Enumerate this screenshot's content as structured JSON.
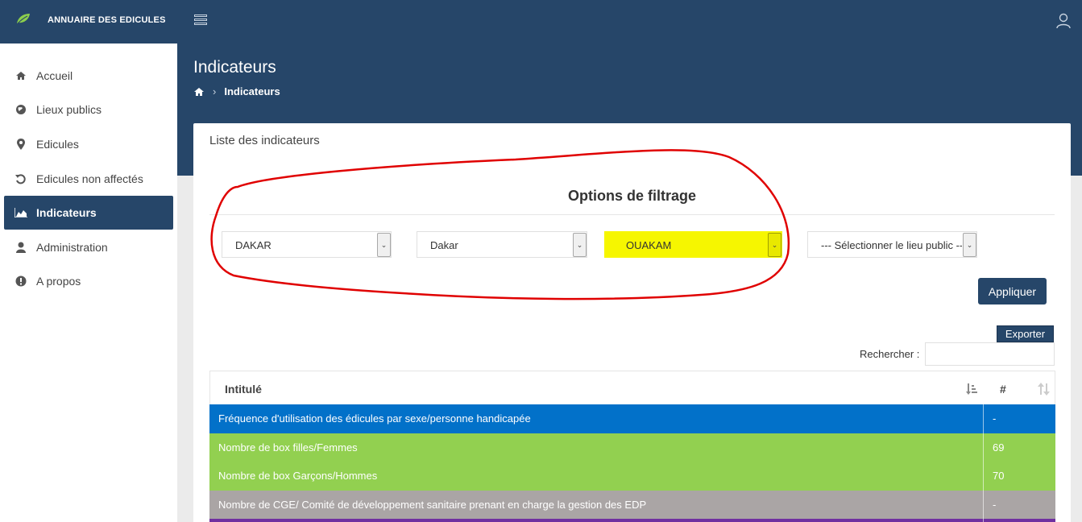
{
  "app": {
    "brand": "ANNUAIRE DES EDICULES"
  },
  "sidebar": {
    "items": [
      {
        "label": "Accueil",
        "icon": "home-icon"
      },
      {
        "label": "Lieux publics",
        "icon": "globe-icon"
      },
      {
        "label": "Edicules",
        "icon": "map-marker-icon"
      },
      {
        "label": "Edicules non affectés",
        "icon": "undo-icon"
      },
      {
        "label": "Indicateurs",
        "icon": "area-chart-icon",
        "active": true
      },
      {
        "label": "Administration",
        "icon": "user-icon"
      },
      {
        "label": "A propos",
        "icon": "info-icon"
      }
    ]
  },
  "header": {
    "title": "Indicateurs",
    "breadcrumb": "Indicateurs"
  },
  "card": {
    "title": "Liste des indicateurs",
    "filter_title": "Options de filtrage",
    "filters": [
      {
        "value": "DAKAR"
      },
      {
        "value": "Dakar"
      },
      {
        "value": "OUAKAM"
      },
      {
        "value": "--- Sélectionner le lieu public ---"
      }
    ],
    "apply_label": "Appliquer",
    "export_label": "Exporter",
    "search_label": "Rechercher :",
    "search_value": ""
  },
  "table": {
    "headers": [
      "Intitulé",
      "#"
    ],
    "rows": [
      {
        "label": "Fréquence d'utilisation des édicules par sexe/personne handicapée",
        "value": "-",
        "color": "#0271c9"
      },
      {
        "label": "Nombre de box filles/Femmes",
        "value": "69",
        "color": "#92d050"
      },
      {
        "label": "Nombre de box Garçons/Hommes",
        "value": "70",
        "color": "#92d050"
      },
      {
        "label": "Nombre de CGE/ Comité de développement sanitaire prenant en charge la gestion des EDP",
        "value": "-",
        "color": "#aaa5a5"
      },
      {
        "label": "",
        "value": "",
        "color": "#7030a0"
      }
    ]
  },
  "colors": {
    "navy": "#264669",
    "highlight": "#f6f600",
    "annotation": "#e00000"
  }
}
